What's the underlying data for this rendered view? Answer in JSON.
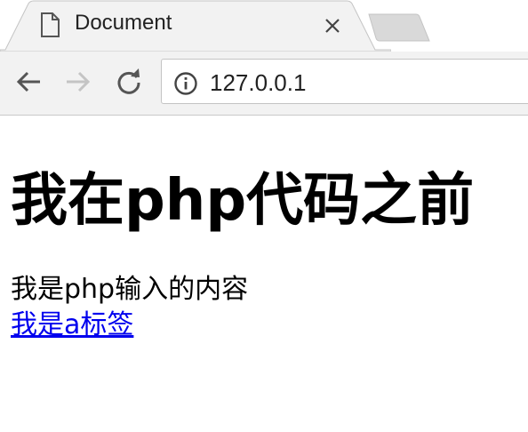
{
  "browser": {
    "tab": {
      "title": "Document",
      "page_icon": "document-icon",
      "close_icon": "close-icon"
    },
    "new_tab_icon": "new-tab-icon",
    "nav": {
      "back_icon": "back-arrow-icon",
      "forward_icon": "forward-arrow-icon",
      "reload_icon": "reload-icon"
    },
    "address_bar": {
      "url": "127.0.0.1",
      "security_icon": "info-icon"
    },
    "colors": {
      "toolbar": "#f2f2f2",
      "tab_strip": "#ffffff",
      "link": "#0000ee"
    }
  },
  "page": {
    "heading": "我在php代码之前",
    "paragraph": "我是php输入的内容",
    "link_text": "我是a标签"
  }
}
